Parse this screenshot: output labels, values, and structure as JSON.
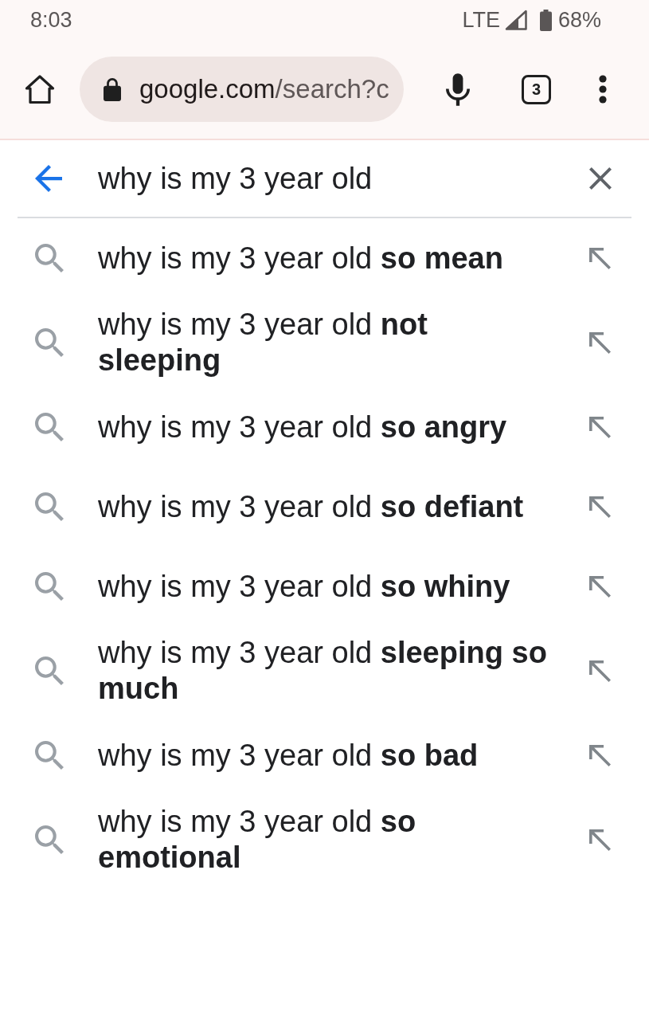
{
  "status_bar": {
    "time": "8:03",
    "network": "LTE",
    "battery": "68%"
  },
  "toolbar": {
    "url": {
      "host": "google.com",
      "path": "/search?c"
    },
    "tab_count": "3"
  },
  "search": {
    "query": "why is my 3 year old"
  },
  "suggestions": [
    {
      "text": "why is my 3 year old **so mean**"
    },
    {
      "text": "why is my 3 year old **not sleeping**"
    },
    {
      "text": "why is my 3 year old **so angry**"
    },
    {
      "text": "why is my 3 year old **so defiant**"
    },
    {
      "text": "why is my 3 year old **so whiny**"
    },
    {
      "text": "why is my 3 year old **sleeping so much**"
    },
    {
      "text": "why is my 3 year old **so bad**"
    },
    {
      "text": "why is my 3 year old **so emotional**"
    }
  ]
}
